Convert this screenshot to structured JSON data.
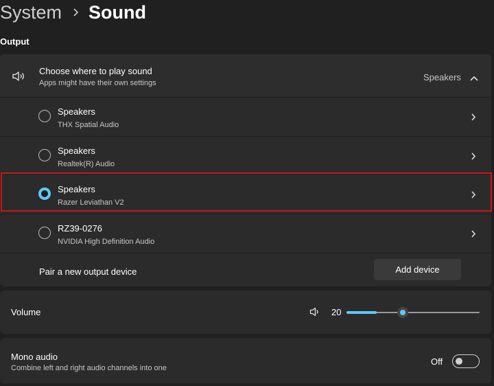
{
  "breadcrumb": {
    "parent": "System",
    "current": "Sound"
  },
  "section": {
    "output_label": "Output"
  },
  "output": {
    "title": "Choose where to play sound",
    "subtitle": "Apps might have their own settings",
    "selected_value": "Speakers",
    "devices": [
      {
        "name": "Speakers",
        "detail": "THX Spatial Audio",
        "selected": false
      },
      {
        "name": "Speakers",
        "detail": "Realtek(R) Audio",
        "selected": false
      },
      {
        "name": "Speakers",
        "detail": "Razer Leviathan V2",
        "selected": true
      },
      {
        "name": "RZ39-0276",
        "detail": "NVIDIA High Definition Audio",
        "selected": false
      }
    ],
    "pair_label": "Pair a new output device",
    "add_button_label": "Add device"
  },
  "volume": {
    "label": "Volume",
    "value": "20",
    "level": 0.2
  },
  "mono_audio": {
    "title": "Mono audio",
    "subtitle": "Combine left and right audio channels into one",
    "state": "Off"
  },
  "colors": {
    "accent": "#60c8f8",
    "highlight_border": "#c41818",
    "background": "#202020",
    "card": "#2b2b2b"
  },
  "icons": {
    "breadcrumb_separator": "chevron-right-icon",
    "output_header": "speaker-icon",
    "collapse": "chevron-up-icon",
    "device_open": "chevron-right-icon",
    "volume": "speaker-icon"
  }
}
